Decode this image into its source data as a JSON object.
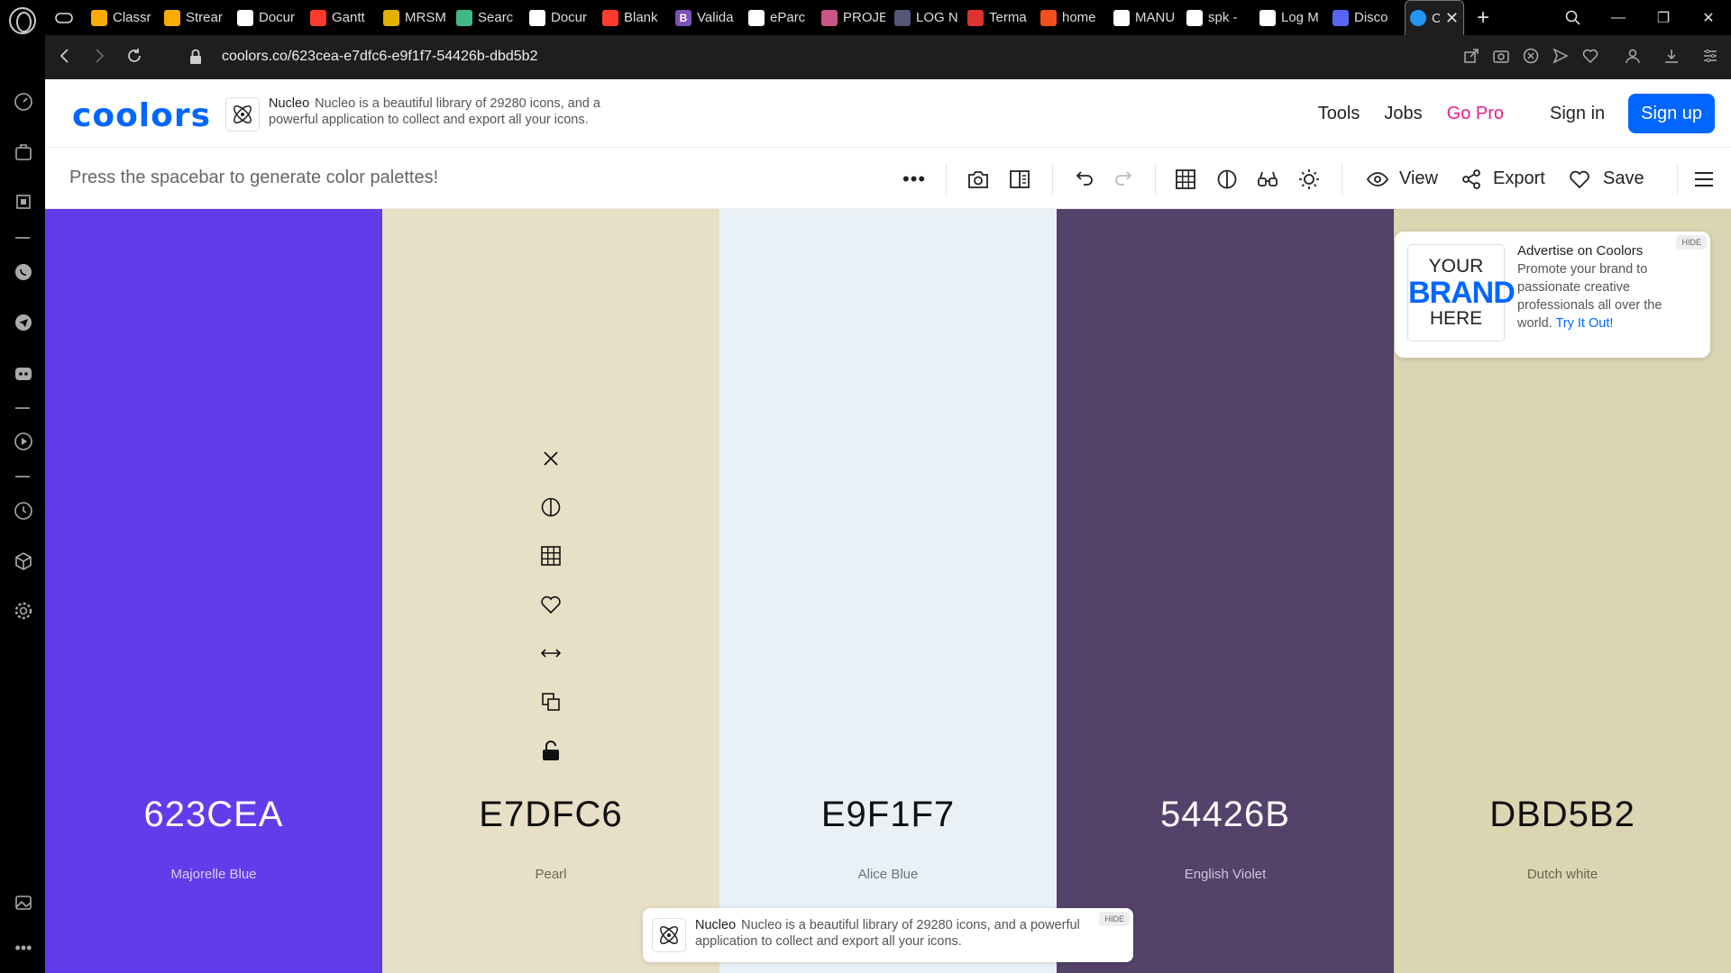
{
  "browser": {
    "tabs": [
      {
        "label": "Classr",
        "icon_color": "#f9ab00"
      },
      {
        "label": "Strear",
        "icon_color": "#f9ab00"
      },
      {
        "label": "Docur",
        "icon_color": "#ffffff"
      },
      {
        "label": "Gantt",
        "icon_color": "#ff3b30"
      },
      {
        "label": "MRSM",
        "icon_color": "#e0b000"
      },
      {
        "label": "Searc",
        "icon_color": "#42b883"
      },
      {
        "label": "Docur",
        "icon_color": "#ffffff"
      },
      {
        "label": "Blank",
        "icon_color": "#ff3b30"
      },
      {
        "label": "Valida",
        "icon_color": "#7952b3",
        "icon_text": "B"
      },
      {
        "label": "eParc",
        "icon_color": "#ffffff"
      },
      {
        "label": "PROJE",
        "icon_color": "#c58"
      },
      {
        "label": "LOG N",
        "icon_color": "#557"
      },
      {
        "label": "Terma",
        "icon_color": "#d33"
      },
      {
        "label": "home",
        "icon_color": "#f24e1e"
      },
      {
        "label": "MANU",
        "icon_color": "#ffffff"
      },
      {
        "label": "spk -",
        "icon_color": "#ffffff"
      },
      {
        "label": "Log M",
        "icon_color": "#ffffff"
      },
      {
        "label": "Disco",
        "icon_color": "#5865f2"
      }
    ],
    "active_tab": {
      "label": "Cr",
      "icon_color": "#2196f3"
    },
    "url": "coolors.co/623cea-e7dfc6-e9f1f7-54426b-dbd5b2"
  },
  "site": {
    "logo": "coolors",
    "ad": {
      "brand": "Nucleo",
      "text": "Nucleo is a beautiful library of 29280 icons, and a powerful application to collect and export all your icons."
    },
    "nav": {
      "tools": "Tools",
      "jobs": "Jobs",
      "go_pro": "Go Pro",
      "sign_in": "Sign in",
      "sign_up": "Sign up"
    }
  },
  "toolbar": {
    "hint": "Press the spacebar to generate color palettes!",
    "view": "View",
    "export": "Export",
    "save": "Save"
  },
  "palette": [
    {
      "hex": "623CEA",
      "name": "Majorelle Blue",
      "color": "#623CEA",
      "text_color": "#ffffff",
      "name_color": "#d8d0f8"
    },
    {
      "hex": "E7DFC6",
      "name": "Pearl",
      "color": "#E7DFC6",
      "text_color": "#111111",
      "name_color": "#6b6657"
    },
    {
      "hex": "E9F1F7",
      "name": "Alice Blue",
      "color": "#E9F1F7",
      "text_color": "#111111",
      "name_color": "#6b7178"
    },
    {
      "hex": "54426B",
      "name": "English Violet",
      "color": "#54426B",
      "text_color": "#ffffff",
      "name_color": "#cdc6d6"
    },
    {
      "hex": "DBD5B2",
      "name": "Dutch white",
      "color": "#DBD5B2",
      "text_color": "#111111",
      "name_color": "#67644f"
    }
  ],
  "ad_card": {
    "brand_l1": "YOUR",
    "brand_l2": "BRAND",
    "brand_l3": "HERE",
    "title": "Advertise on Coolors",
    "body": "Promote your brand to passionate creative professionals all over the world.",
    "link": "Try It Out!",
    "hide": "HIDE"
  },
  "ad_bottom": {
    "brand": "Nucleo",
    "text": "Nucleo is a beautiful library of 29280 icons, and a powerful application to collect and export all your icons.",
    "hide": "HIDE"
  }
}
